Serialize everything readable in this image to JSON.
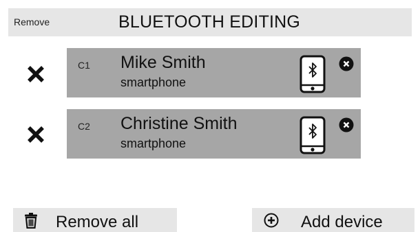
{
  "header": {
    "remove_label": "Remove",
    "title": "BLUETOOTH EDITING"
  },
  "devices": [
    {
      "slot": "C1",
      "name": "Mike Smith",
      "type": "smartphone",
      "icon": "smartphone-bluetooth-icon"
    },
    {
      "slot": "C2",
      "name": "Christine Smith",
      "type": "smartphone",
      "icon": "smartphone-bluetooth-icon"
    }
  ],
  "footer": {
    "remove_all_label": "Remove all",
    "remove_all_icon": "trash-icon",
    "add_device_label": "Add device",
    "add_device_icon": "plus-circle-icon"
  },
  "colors": {
    "header_bg": "#e6e6e6",
    "card_bg": "#a6a6a6",
    "button_bg": "#e6e6e6",
    "text": "#111111"
  }
}
